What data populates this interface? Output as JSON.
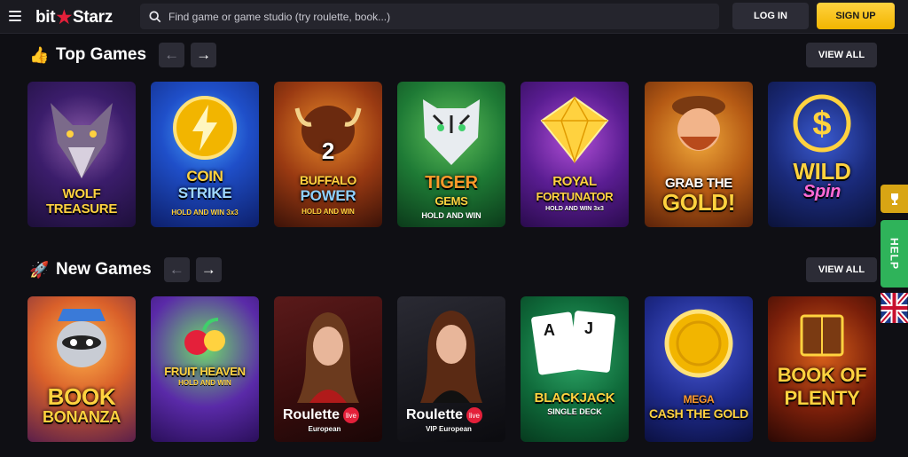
{
  "header": {
    "logo_left": "bit",
    "logo_right": "Starz",
    "search_placeholder": "Find game or game studio (try roulette, book...)",
    "login_label": "LOG IN",
    "signup_label": "SIGN UP"
  },
  "sections": [
    {
      "title": "Top Games",
      "emoji": "👍",
      "view_all": "VIEW ALL",
      "games": [
        {
          "line1": "WOLF",
          "line2": "TREASURE",
          "sub": ""
        },
        {
          "line1": "COIN",
          "line2": "STRIKE",
          "sub": "HOLD AND WIN 3x3"
        },
        {
          "line1": "BUFFALO",
          "line2": "POWER",
          "sub": "HOLD AND WIN"
        },
        {
          "line1": "TIGER",
          "line2": "GEMS",
          "sub": "HOLD AND WIN"
        },
        {
          "line1": "ROYAL",
          "line2": "FORTUNATOR",
          "sub": "HOLD AND WIN 3x3"
        },
        {
          "line1": "GRAB THE",
          "line2": "GOLD!",
          "sub": ""
        },
        {
          "line1": "WILD",
          "line2": "Spin",
          "sub": ""
        }
      ]
    },
    {
      "title": "New Games",
      "emoji": "🚀",
      "view_all": "VIEW ALL",
      "games": [
        {
          "line1": "BOOK",
          "line2": "BONANZA",
          "sub": ""
        },
        {
          "line1": "FRUIT HEAVEN",
          "line2": "",
          "sub": "HOLD AND WIN"
        },
        {
          "line1": "Roulette",
          "line2": "",
          "sub": "European",
          "badge": "live"
        },
        {
          "line1": "Roulette",
          "line2": "",
          "sub": "VIP European",
          "badge": "live"
        },
        {
          "line1": "BLACKJACK",
          "line2": "",
          "sub": "SINGLE DECK"
        },
        {
          "line1": "MEGA",
          "line2": "CASH THE GOLD",
          "sub": ""
        },
        {
          "line1": "BOOK OF",
          "line2": "PLENTY",
          "sub": ""
        }
      ]
    }
  ],
  "side": {
    "help_label": "HELP",
    "cup_icon": "trophy-icon",
    "flag_icon": "uk-flag-icon"
  },
  "colors": {
    "accent_yellow": "#f2b500",
    "logo_star": "#e4203a",
    "help_green": "#2fb35a",
    "background": "#0f0f14"
  }
}
